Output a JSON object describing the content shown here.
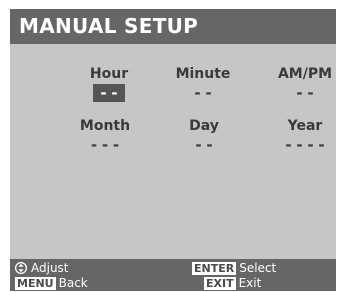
{
  "title": "MANUAL SETUP",
  "fields": {
    "hour": {
      "label": "Hour",
      "value": "--",
      "selected": true
    },
    "minute": {
      "label": "Minute",
      "value": "--",
      "selected": false
    },
    "ampm": {
      "label": "AM/PM",
      "value": "--",
      "selected": false
    },
    "month": {
      "label": "Month",
      "value": "---",
      "selected": false
    },
    "day": {
      "label": "Day",
      "value": "--",
      "selected": false
    },
    "year": {
      "label": "Year",
      "value": "----",
      "selected": false
    }
  },
  "footer": {
    "adjust": {
      "icon": "up-down-arrows-icon",
      "label": "Adjust"
    },
    "enter": {
      "key": "ENTER",
      "label": "Select"
    },
    "menu": {
      "key": "MENU",
      "label": "Back"
    },
    "exit": {
      "key": "EXIT",
      "label": "Exit"
    }
  },
  "colors": {
    "title_bar": "#666666",
    "panel": "#c6c6c6",
    "text": "#3a3a3a",
    "selected": "#555555"
  }
}
